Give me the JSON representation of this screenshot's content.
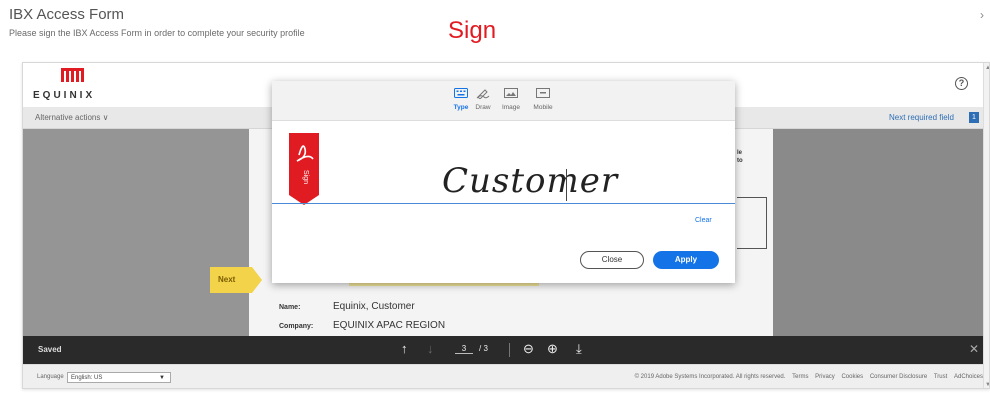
{
  "header": {
    "title": "IBX Access Form",
    "subtitle": "Please sign the IBX Access Form in order to complete your security profile",
    "annotation": "Sign",
    "close_glyph": "›"
  },
  "viewer": {
    "logo_text": "EQUINIX",
    "help_glyph": "?",
    "alternative_actions": "Alternative actions ∨",
    "next_required_field": "Next required field",
    "next_required_badge": "1",
    "document": {
      "side_text": "le\nto",
      "name_label": "Name:",
      "name_value": "Equinix, Customer",
      "company_label": "Company:",
      "company_value": "EQUINIX APAC REGION"
    },
    "next_tag": "Next",
    "toolbar": {
      "saved": "Saved",
      "page_current": "3",
      "page_total": "/ 3"
    },
    "footer": {
      "language_label": "Language",
      "language_value": "English: US",
      "links": [
        "© 2019 Adobe Systems Incorporated. All rights reserved.",
        "Terms",
        "Privacy",
        "Cookies",
        "Consumer Disclosure",
        "Trust",
        "AdChoices"
      ]
    }
  },
  "signature_dialog": {
    "tabs": [
      {
        "label": "Type",
        "icon": "keyboard-icon",
        "active": true
      },
      {
        "label": "Draw",
        "icon": "pen-icon",
        "active": false
      },
      {
        "label": "Image",
        "icon": "image-icon",
        "active": false
      },
      {
        "label": "Mobile",
        "icon": "mobile-icon",
        "active": false
      }
    ],
    "tag_text": "Sign",
    "signature_text": "Customer",
    "clear": "Clear",
    "close_button": "Close",
    "apply_button": "Apply"
  },
  "colors": {
    "accent_blue": "#1473e6",
    "brand_red": "#e11b22",
    "next_yellow": "#f3d34a"
  }
}
